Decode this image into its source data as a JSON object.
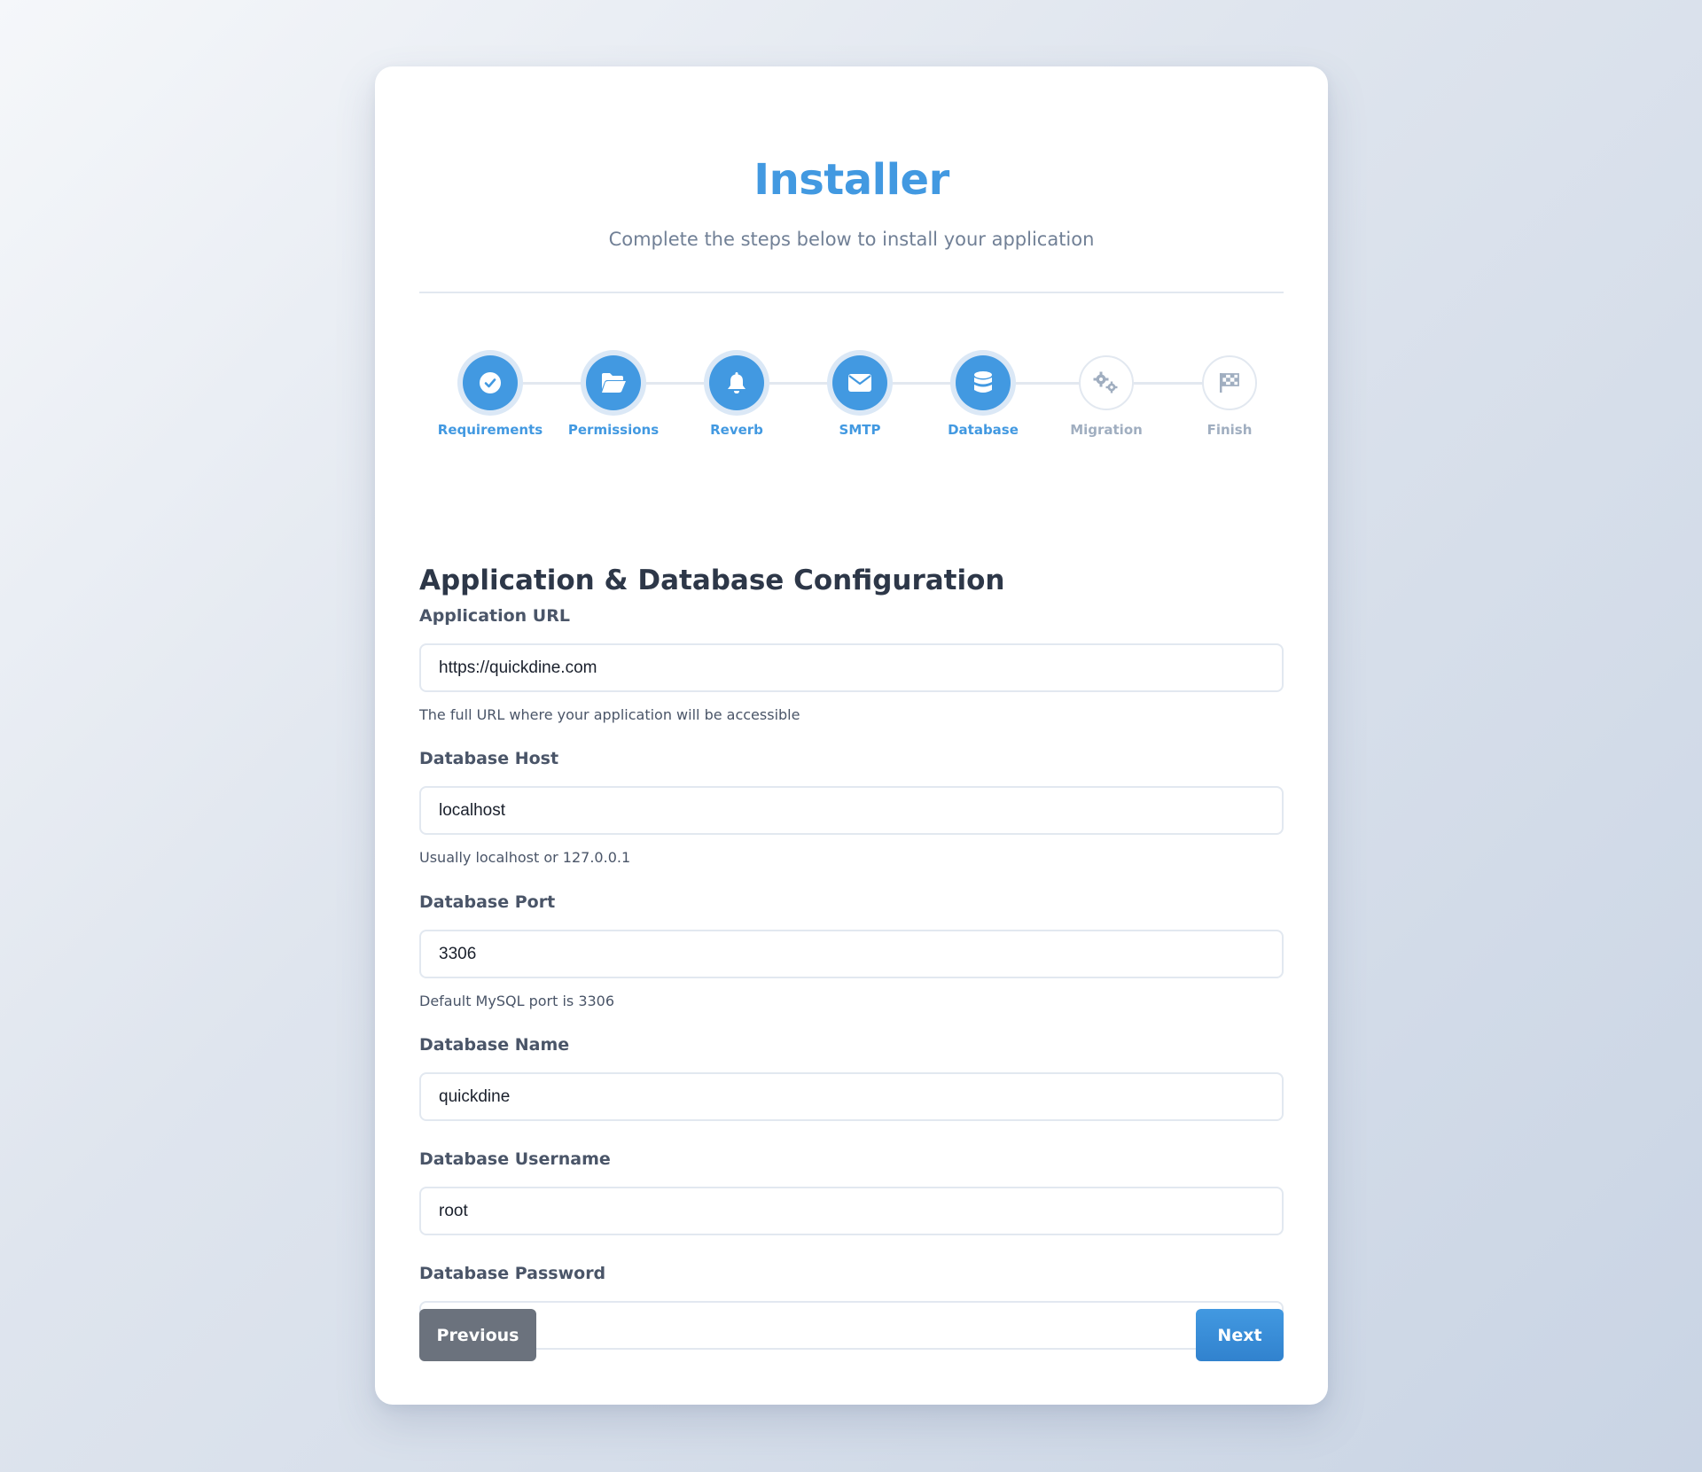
{
  "header": {
    "title": "Installer",
    "subtitle": "Complete the steps below to install your application"
  },
  "steps": [
    {
      "label": "Requirements",
      "icon": "check-circle-icon",
      "status": "done"
    },
    {
      "label": "Permissions",
      "icon": "folder-open-icon",
      "status": "done"
    },
    {
      "label": "Reverb",
      "icon": "bell-icon",
      "status": "done"
    },
    {
      "label": "SMTP",
      "icon": "envelope-icon",
      "status": "done"
    },
    {
      "label": "Database",
      "icon": "database-icon",
      "status": "current"
    },
    {
      "label": "Migration",
      "icon": "gears-icon",
      "status": "pending"
    },
    {
      "label": "Finish",
      "icon": "flag-checkered-icon",
      "status": "pending"
    }
  ],
  "form": {
    "section_title": "Application & Database Configuration",
    "fields": [
      {
        "label": "Application URL",
        "value": "https://quickdine.com",
        "help": "The full URL where your application will be accessible"
      },
      {
        "label": "Database Host",
        "value": "localhost",
        "help": "Usually localhost or 127.0.0.1"
      },
      {
        "label": "Database Port",
        "value": "3306",
        "help": "Default MySQL port is 3306"
      },
      {
        "label": "Database Name",
        "value": "quickdine",
        "help": ""
      },
      {
        "label": "Database Username",
        "value": "root",
        "help": ""
      },
      {
        "label": "Database Password",
        "value": "",
        "help": ""
      }
    ]
  },
  "buttons": {
    "previous": "Previous",
    "next": "Next"
  },
  "colors": {
    "accent": "#4299e1",
    "pending": "#a0aec0",
    "heading": "#2d3748",
    "secondary_button": "#6b727d"
  }
}
